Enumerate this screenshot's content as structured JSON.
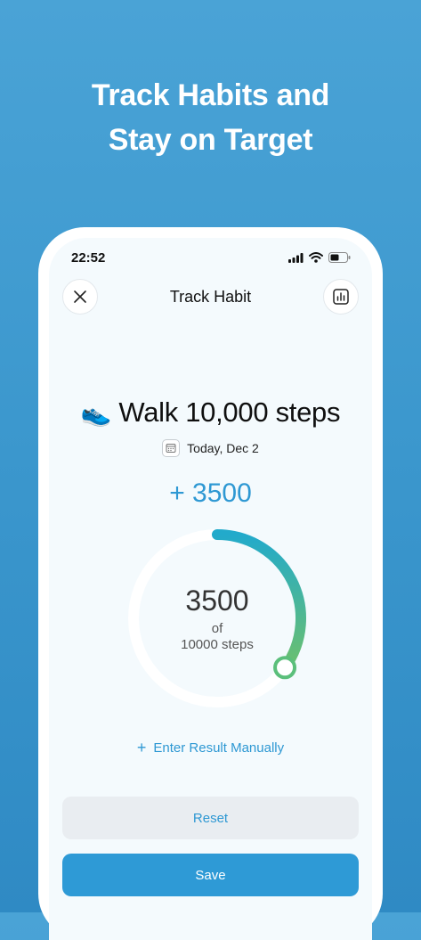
{
  "headline": {
    "line1": "Track Habits and",
    "line2": "Stay on Target"
  },
  "status_bar": {
    "time": "22:52",
    "icons": [
      "signal-icon",
      "wifi-icon",
      "battery-icon"
    ]
  },
  "nav": {
    "title": "Track Habit",
    "left_icon": "close-icon",
    "right_icon": "stats-chart-icon"
  },
  "habit": {
    "emoji": "👟",
    "title": "Walk 10,000 steps",
    "date": "Today, Dec 2",
    "increment": "+ 3500"
  },
  "progress": {
    "value": "3500",
    "of_label": "of",
    "goal_label": "10000 steps",
    "fraction": 0.35,
    "color_start": "#22aacb",
    "color_end": "#6cc06d"
  },
  "actions": {
    "manual_label": "Enter Result Manually",
    "reset_label": "Reset",
    "save_label": "Save"
  },
  "colors": {
    "accent": "#2e98d3",
    "background": "#3b97cd"
  }
}
